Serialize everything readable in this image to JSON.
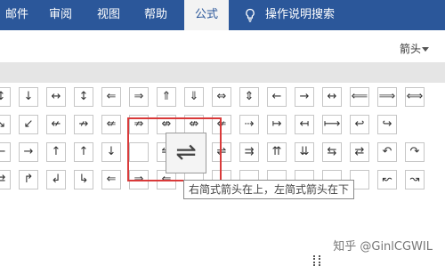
{
  "ribbon": {
    "tabs": [
      {
        "label": "邮件"
      },
      {
        "label": "审阅"
      },
      {
        "label": "视图"
      },
      {
        "label": "帮助"
      },
      {
        "label": "公式"
      },
      {
        "label": "操作说明搜索"
      }
    ],
    "active_tab": "公式",
    "search_icon": "lightbulb-icon"
  },
  "symbols_panel": {
    "category": "箭头",
    "rows": [
      [
        "↕",
        "↓",
        "↔",
        "↕",
        "⇐",
        "⇒",
        "⇑",
        "⇓",
        "⇔",
        "⇕",
        "←",
        "→",
        "↔",
        "⟸",
        "⟹",
        "⟺"
      ],
      [
        "↘",
        "↙",
        "↚",
        "↛",
        "⇍",
        "⇏",
        "⇎",
        "⇎",
        "⇍",
        "⇢",
        "↦",
        "↤",
        "⟼",
        "↩",
        "↪"
      ],
      [
        "←",
        "→",
        "↑",
        "↑",
        "↓",
        "",
        "⇋",
        "",
        "⇌",
        "⇉",
        "⇈",
        "⇊",
        "⇆",
        "⇄",
        "↶",
        "↷"
      ],
      [
        "⇄",
        "↱",
        "↲",
        "↳",
        "⇐",
        "⇒",
        "⇐",
        "",
        "",
        "",
        "",
        "",
        "",
        "",
        "↜",
        "↝"
      ]
    ],
    "highlighted_symbol": "⇌",
    "tooltip": "右简式箭头在上，左简式箭头在下"
  },
  "watermark": "知乎 @GinlCGWIL",
  "colors": {
    "ribbon": "#2b579a",
    "highlight_border": "#d93a3a"
  }
}
